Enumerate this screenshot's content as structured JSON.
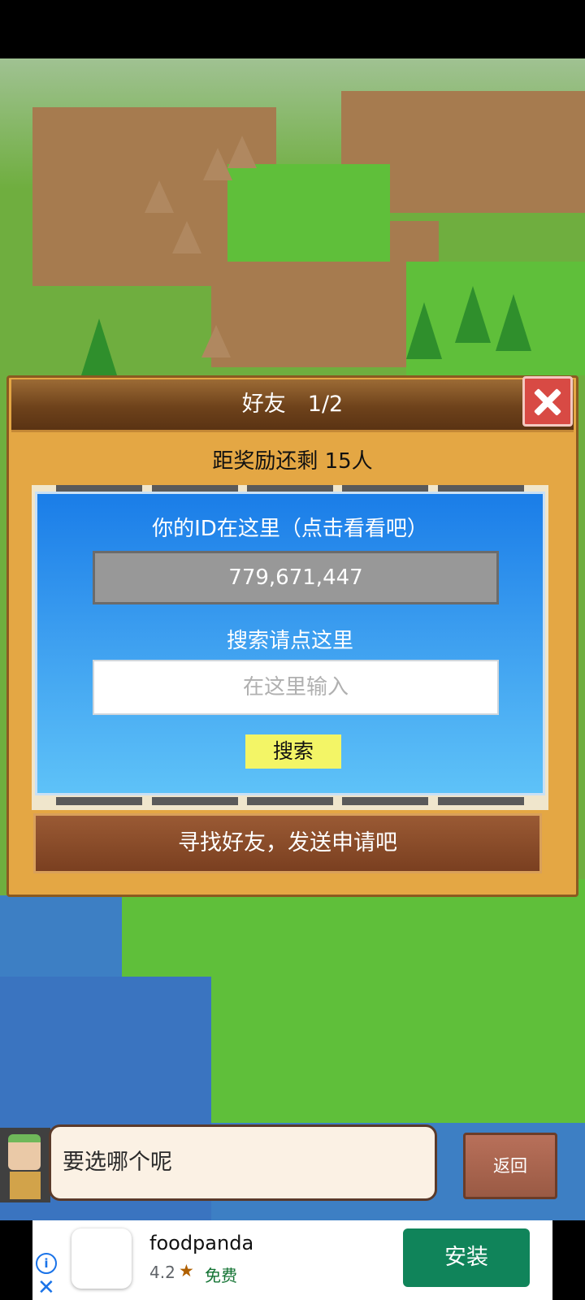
{
  "dialog": {
    "title": "好友　1/2",
    "reward_text": "距奖励还剩 15人",
    "id_label": "你的ID在这里（点击看看吧）",
    "player_id": "779,671,447",
    "search_label": "搜索请点这里",
    "search_placeholder": "在这里输入",
    "search_button": "搜索",
    "find_friends_button": "寻找好友，发送申请吧"
  },
  "chat": {
    "message": "要选哪个呢",
    "back_button": "返回"
  },
  "ad": {
    "app_name": "foodpanda",
    "rating": "4.2",
    "price": "免费",
    "install_button": "安装",
    "icons": [
      "info-icon",
      "close-icon",
      "star-icon"
    ]
  },
  "colors": {
    "dialog_bg": "#e4a744",
    "panel_blue": "#1a7de8",
    "close_red": "#d84a44",
    "search_button_yellow": "#f3f566",
    "install_green": "#10845a"
  }
}
